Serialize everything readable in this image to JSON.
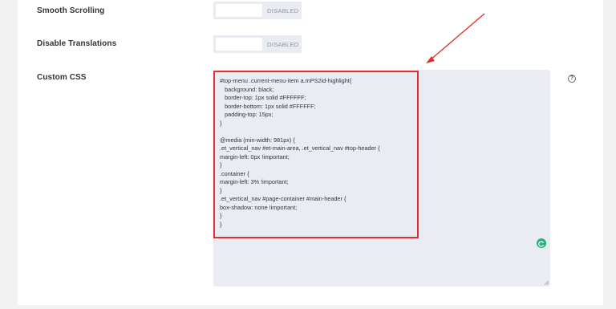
{
  "settings": {
    "smooth_scrolling": {
      "label": "Smooth Scrolling",
      "state": "DISABLED"
    },
    "disable_translations": {
      "label": "Disable Translations",
      "state": "DISABLED"
    },
    "custom_css": {
      "label": "Custom CSS",
      "code": "#top-menu .current-menu-item a.mPS2id-highlight{\n   background: black;\n   border-top: 1px solid #FFFFFF;\n   border-bottom: 1px solid #FFFFFF;\n   padding-top: 15px;\n}\n\n@media (min-width: 981px) {\n.et_vertical_nav #et-main-area, .et_vertical_nav #top-header {\nmargin-left: 0px !important;\n}\n.container {\nmargin-left: 3% !important;\n}\n.et_vertical_nav #page-container #main-header {\nbox-shadow: none !important;\n}\n}"
    },
    "help_icon_glyph": "?"
  },
  "colors": {
    "annotation_red": "#e03131",
    "field_bg": "#e9edf3",
    "badge_green": "#22b07d"
  },
  "icons": {
    "help": "question-circle-icon",
    "badge": "green-refresh-badge-icon",
    "arrow": "red-annotation-arrow-icon",
    "grip": "resize-grip-icon"
  }
}
